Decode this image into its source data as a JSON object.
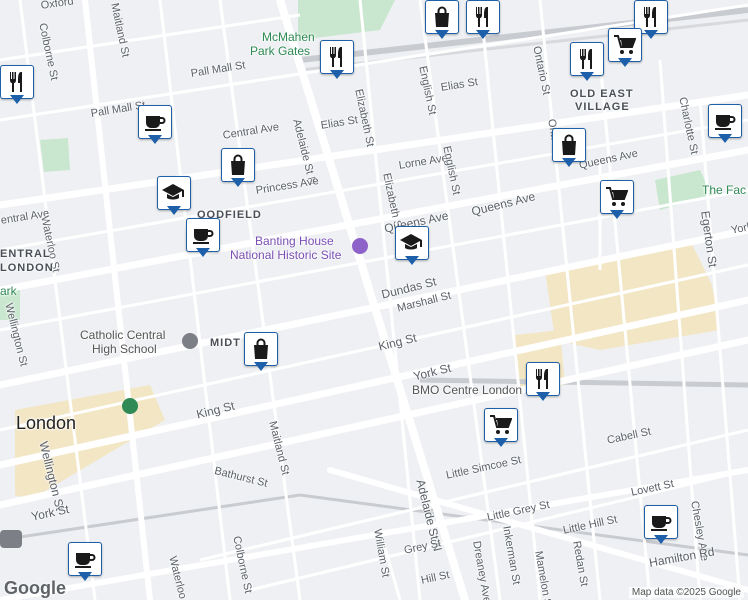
{
  "map": {
    "attribution": "Map data ©2025 Google",
    "logo": "Google",
    "colors": {
      "road": "#ffffff",
      "background": "#eef0f3",
      "park": "#c9e7cf",
      "rail": "#c8cbd0",
      "commercial": "#f3e6c4",
      "marker_border": "#1d5fa8"
    }
  },
  "streets": {
    "oxford": "Oxford",
    "maitland_n": "Maitland St",
    "pall_mall_w": "Pall Mall St",
    "pall_mall_e": "Pall Mall St",
    "elizabeth_n": "Elizabeth St",
    "english_n": "English St",
    "elias": "Elias St",
    "ontario": "Ontario St",
    "colborne_n": "Colborne St",
    "central_ave_e": "Central Ave",
    "elias_w": "Elias St",
    "adelaide_n": "Adelaide St N",
    "lorne": "Lorne Ave",
    "english_s": "English St",
    "queens_ne": "Queens Ave",
    "princess": "Princess Ave",
    "elizabeth_s": "Elizabeth St",
    "charlotte": "Charlotte St",
    "queens_e": "Queens Ave",
    "central_ave_w": "entral Ave",
    "waterloo_n": "Waterloo St",
    "queens_mid": "Queens Ave",
    "york_e": "York",
    "egerton": "Egerton St",
    "dundas": "Dundas St",
    "marshall": "Marshall St",
    "wellington_n": "Wellington St",
    "king_e": "King St",
    "york_mid": "York St",
    "king_w": "King St",
    "wellington_s": "Wellington St",
    "maitland_s": "Maitland St",
    "cabell": "Cabell St",
    "little_simcoe": "Little Simcoe St",
    "bathurst": "Bathurst St",
    "lovett": "Lovett St",
    "york_w": "York St",
    "little_grey": "Little Grey St",
    "little_hill": "Little Hill St",
    "chesley": "Chesley Ave",
    "adelaide_s": "Adelaide St N",
    "colborne_s": "Colborne St",
    "william": "William St",
    "grey": "Grey St",
    "dreaney": "Dreaney Ave",
    "inkerman": "Inkerman St",
    "mamelon": "Mamelon St",
    "redan": "Redan St",
    "hamilton": "Hamilton Rd",
    "hill": "Hill St",
    "waterloo_s": "Waterloo",
    "ontario_s": "Ontario",
    "york_left": "York St"
  },
  "areas": {
    "old_east_village_1": "OLD EAST",
    "old_east_village_2": "VILLAGE",
    "woodfield": "OODFIELD",
    "central_london_1": "ENTRAL",
    "central_london_2": "LONDON",
    "midtown": "MIDT",
    "city": "London"
  },
  "places": {
    "mcmahen_1": "McMahen",
    "mcmahen_2": "Park Gates",
    "banting_1": "Banting House",
    "banting_2": "National Historic Site",
    "catholic_1": "Catholic Central",
    "catholic_2": "High School",
    "bmo": "BMO Centre London",
    "the_fac": "The Fac",
    "park_left": "ark"
  },
  "markers": [
    {
      "icon": "shopping-bag"
    },
    {
      "icon": "restaurant"
    },
    {
      "icon": "restaurant"
    },
    {
      "icon": "restaurant"
    },
    {
      "icon": "restaurant"
    },
    {
      "icon": "shopping-cart"
    },
    {
      "icon": "restaurant"
    },
    {
      "icon": "cafe"
    },
    {
      "icon": "cafe"
    },
    {
      "icon": "shopping-bag"
    },
    {
      "icon": "shopping-bag"
    },
    {
      "icon": "school"
    },
    {
      "icon": "cafe"
    },
    {
      "icon": "school"
    },
    {
      "icon": "shopping-cart"
    },
    {
      "icon": "shopping-bag"
    },
    {
      "icon": "restaurant"
    },
    {
      "icon": "shopping-cart"
    },
    {
      "icon": "cafe"
    },
    {
      "icon": "cafe"
    }
  ]
}
